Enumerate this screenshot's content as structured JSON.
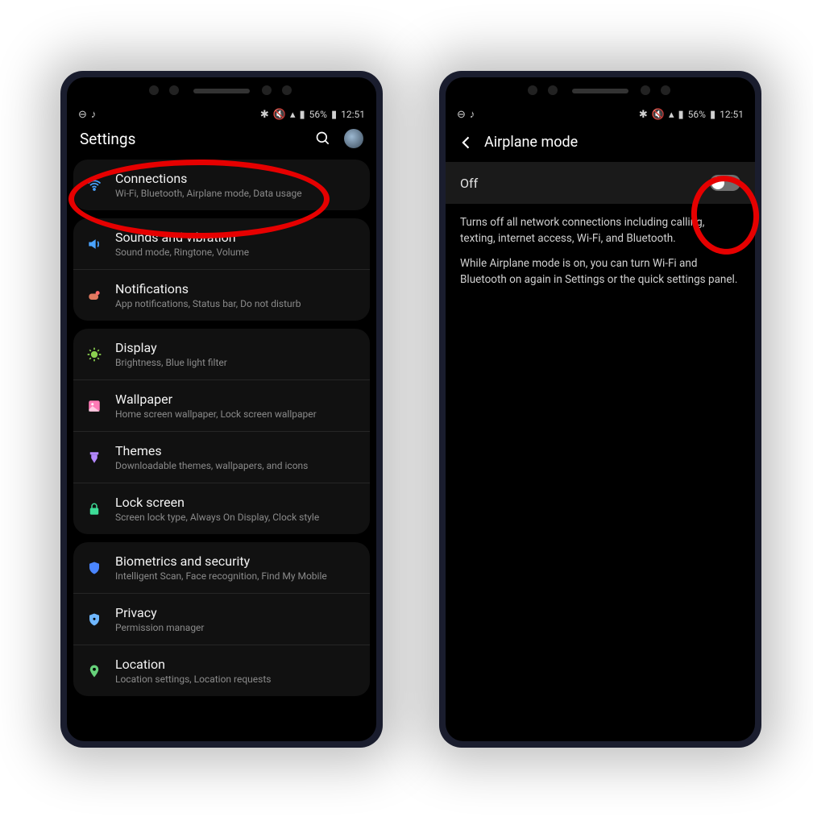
{
  "status": {
    "battery_text": "56%",
    "time": "12:51"
  },
  "left": {
    "header_title": "Settings",
    "groups": [
      {
        "items": [
          {
            "icon": "wifi",
            "color": "#4aa3ff",
            "label": "Connections",
            "sub": "Wi-Fi, Bluetooth, Airplane mode, Data usage"
          }
        ]
      },
      {
        "items": [
          {
            "icon": "sound",
            "color": "#4aa3ff",
            "label": "Sounds and vibration",
            "sub": "Sound mode, Ringtone, Volume"
          },
          {
            "icon": "notif",
            "color": "#e07a5f",
            "label": "Notifications",
            "sub": "App notifications, Status bar, Do not disturb"
          }
        ]
      },
      {
        "items": [
          {
            "icon": "display",
            "color": "#8bd14f",
            "label": "Display",
            "sub": "Brightness, Blue light filter"
          },
          {
            "icon": "wall",
            "color": "#ff7ab6",
            "label": "Wallpaper",
            "sub": "Home screen wallpaper, Lock screen wallpaper"
          },
          {
            "icon": "themes",
            "color": "#b388ff",
            "label": "Themes",
            "sub": "Downloadable themes, wallpapers, and icons"
          },
          {
            "icon": "lock",
            "color": "#3ddc97",
            "label": "Lock screen",
            "sub": "Screen lock type, Always On Display, Clock style"
          }
        ]
      },
      {
        "items": [
          {
            "icon": "shield",
            "color": "#4a85ff",
            "label": "Biometrics and security",
            "sub": "Intelligent Scan, Face recognition, Find My Mobile"
          },
          {
            "icon": "shield2",
            "color": "#6fb7ff",
            "label": "Privacy",
            "sub": "Permission manager"
          },
          {
            "icon": "pin",
            "color": "#66d17a",
            "label": "Location",
            "sub": "Location settings, Location requests"
          }
        ]
      }
    ]
  },
  "right": {
    "header_title": "Airplane mode",
    "toggle_state": "Off",
    "desc1": "Turns off all network connections including calling, texting, internet access, Wi-Fi, and Bluetooth.",
    "desc2": "While Airplane mode is on, you can turn Wi-Fi and Bluetooth on again in Settings or the quick settings panel."
  }
}
